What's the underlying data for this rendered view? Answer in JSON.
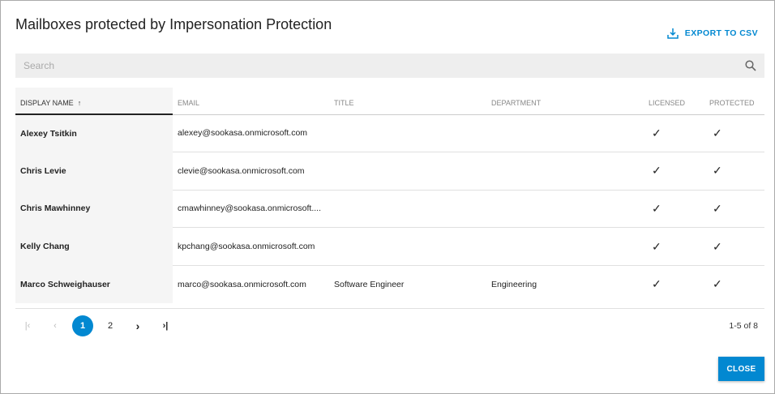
{
  "dialog": {
    "title": "Mailboxes protected by Impersonation Protection",
    "export_label": "EXPORT TO CSV",
    "close_label": "CLOSE"
  },
  "search": {
    "placeholder": "Search"
  },
  "columns": [
    "DISPLAY NAME",
    "EMAIL",
    "TITLE",
    "DEPARTMENT",
    "LICENSED",
    "PROTECTED"
  ],
  "sort_indicator": "↑",
  "rows": [
    {
      "name": "Alexey Tsitkin",
      "email": "alexey@sookasa.onmicrosoft.com",
      "title": "",
      "department": "",
      "licensed": "✓",
      "protected": "✓"
    },
    {
      "name": "Chris Levie",
      "email": "clevie@sookasa.onmicrosoft.com",
      "title": "",
      "department": "",
      "licensed": "✓",
      "protected": "✓"
    },
    {
      "name": "Chris Mawhinney",
      "email": "cmawhinney@sookasa.onmicrosoft....",
      "title": "",
      "department": "",
      "licensed": "✓",
      "protected": "✓"
    },
    {
      "name": "Kelly Chang",
      "email": "kpchang@sookasa.onmicrosoft.com",
      "title": "",
      "department": "",
      "licensed": "✓",
      "protected": "✓"
    },
    {
      "name": "Marco Schweighauser",
      "email": "marco@sookasa.onmicrosoft.com",
      "title": "Software Engineer",
      "department": "Engineering",
      "licensed": "✓",
      "protected": "✓"
    }
  ],
  "pagination": {
    "pages": [
      "1",
      "2"
    ],
    "current": "1",
    "range": "1-5 of 8",
    "first": "|‹",
    "prev": "‹",
    "next": "›",
    "last": "›|"
  },
  "colors": {
    "accent": "#0288d1"
  }
}
